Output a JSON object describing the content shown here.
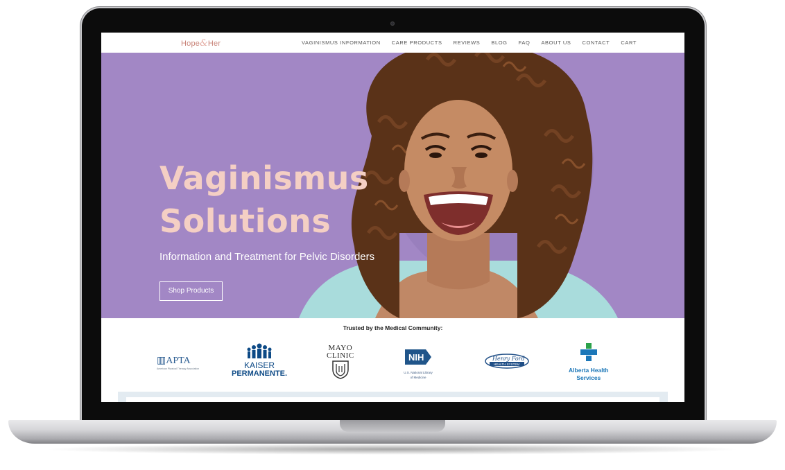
{
  "site": {
    "logo_left": "Hope",
    "logo_amp": "&",
    "logo_right": "Her"
  },
  "nav": {
    "items": [
      "VAGINISMUS INFORMATION",
      "CARE PRODUCTS",
      "REVIEWS",
      "BLOG",
      "FAQ",
      "ABOUT US",
      "CONTACT",
      "CART"
    ]
  },
  "hero": {
    "title_line1": "Vaginismus",
    "title_line2": "Solutions",
    "subtitle": "Information and Treatment for Pelvic Disorders",
    "button_label": "Shop Products"
  },
  "trusted": {
    "heading": "Trusted by the Medical Community:",
    "apta_name": "APTA",
    "apta_sub": "American Physical Therapy Association",
    "kaiser_line1": "KAISER",
    "kaiser_line2": "PERMANENTE.",
    "mayo_line1": "MAYO",
    "mayo_line2": "CLINIC",
    "nih_name": "NIH",
    "nih_sub1": "U.S. National Library",
    "nih_sub2": "of Medicine",
    "henryford_script": "Henry Ford",
    "henryford_sub": "HEALTH SYSTEM",
    "ahs_line1": "Alberta Health",
    "ahs_line2": "Services"
  },
  "colors": {
    "hero_bg": "#a287c5",
    "title_pink": "#f4cfc4",
    "logo_brand": "#c98479"
  }
}
